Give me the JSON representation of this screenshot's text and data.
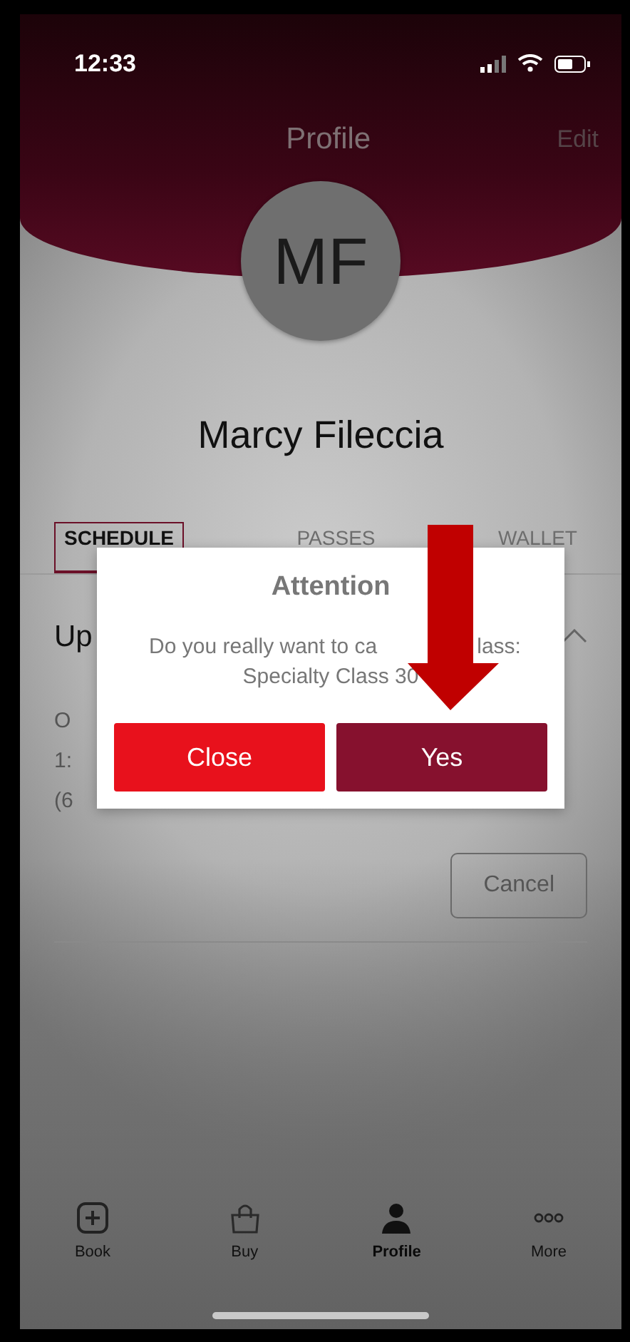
{
  "status_bar": {
    "time": "12:33"
  },
  "header": {
    "title": "Profile",
    "action": "Edit"
  },
  "avatar": {
    "initials": "MF"
  },
  "name": "Marcy Fileccia",
  "tabs": [
    {
      "label": "SCHEDULE",
      "selected": true
    },
    {
      "label": "PASSES",
      "selected": false
    },
    {
      "label": "WALLET",
      "selected": false
    }
  ],
  "section": {
    "heading": "Up",
    "expanded": true,
    "lines": [
      "O",
      "1:",
      "(6"
    ],
    "cancel_button": "Cancel"
  },
  "dialog": {
    "title": "Attention",
    "message_parts": [
      "Do you really want to ca",
      "lass:"
    ],
    "message_line_2": "Specialty Class 30",
    "buttons": [
      {
        "label": "Close",
        "kind": "dismiss"
      },
      {
        "label": "Yes",
        "kind": "confirm"
      }
    ]
  },
  "tab_bar": [
    {
      "label": "Book",
      "kind": "book",
      "selected": false
    },
    {
      "label": "Buy",
      "kind": "buy",
      "selected": false
    },
    {
      "label": "Profile",
      "kind": "profile",
      "selected": true
    },
    {
      "label": "More",
      "kind": "more",
      "selected": false
    }
  ]
}
